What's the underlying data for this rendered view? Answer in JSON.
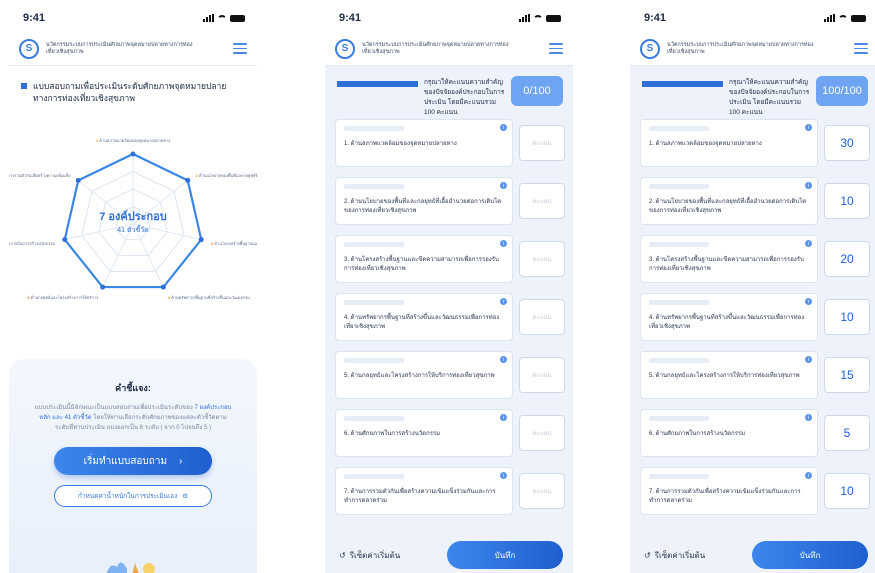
{
  "status": {
    "time": "9:41"
  },
  "app": {
    "title": "นวัตกรรมระบบการประเมินศักยภาพจุดหมายปลายทางการท่องเที่ยวเชิงสุขภาพ"
  },
  "survey": {
    "heading": "แบบสอบถามเพื่อประเมินระดับศักยภาพจุดหมายปลายทางการท่องเที่ยวเชิงสุขภาพ",
    "center_main": "7 องค์ประกอบ",
    "center_sub": "41 ตัวชี้วัด",
    "components": [
      {
        "num": "1",
        "text": "ด้านสภาพแวดล้อมของจุดหมายปลายทาง"
      },
      {
        "num": "2",
        "text": "ด้านนโยบายของพื้นที่และกลยุทธ์ที่เอื้ออำนวยต่อการเติบโต"
      },
      {
        "num": "3",
        "text": "ด้านโครงสร้างพื้นฐานและขีดความสามารถ"
      },
      {
        "num": "4",
        "text": "ด้านทรัพยากรพื้นฐานที่สร้างขึ้นและวัฒนธรรม"
      },
      {
        "num": "5",
        "text": "ด้านกลยุทธ์และโครงสร้างการให้บริการ"
      },
      {
        "num": "6",
        "text": "ด้านศักยภาพในการสร้างนวัตกรรม"
      },
      {
        "num": "7",
        "text": "ด้านการรวมตัวกันเพื่อสร้างความเข้มแข็ง"
      }
    ],
    "instructions_title": "คำชี้แจง:",
    "instructions_pre": "แบบประเมินนี้มีลักษณะเป็นแบบสอบถามเพื่อประเมินระดับของ",
    "instructions_highlight": "7 องค์ประกอบหลัก และ 41 ตัวชี้วัด",
    "instructions_post": "โดยให้ท่านเลือกระดับศักยภาพของแต่ละตัวชี้วัดตามระดับที่ท่านประเมิน แบ่งออกเป็น 6 ระดับ ( จาก 0 ไปจนถึง 5 )",
    "start_label": "เริ่มทำแบบสอบถาม",
    "start_arrow": "›",
    "weight_label": "กำหนดค่าน้ำหนักในการประเมินเอง",
    "gear": "⚙"
  },
  "weights": {
    "instruction": "กรุณาให้คะแนนความสำคัญของปัจจัยองค์ประกอบในการประเมิน โดยมีคะแนนรวม 100 คะแนน",
    "placeholder": "คะแนน",
    "items": [
      "1. ด้านสภาพแวดล้อมของจุดหมายปลายทาง",
      "2. ด้านนโยบายของพื้นที่และกลยุทธ์ที่เอื้ออำนวยต่อการเติบโตของการท่องเที่ยวเชิงสุขภาพ",
      "3. ด้านโครงสร้างพื้นฐานและขีดความสามารถเพื่อการรองรับการท่องเที่ยวเชิงสุขภาพ",
      "4. ด้านทรัพยากรพื้นฐานที่สร้างขึ้นและวัฒนธรรมเพื่อการท่องเที่ยวเชิงสุขภาพ",
      "5. ด้านกลยุทธ์และโครงสร้างการให้บริการท่องเที่ยวสุขภาพ",
      "6. ด้านศักยภาพในการสร้างนวัตกรรม",
      "7. ด้านการรวมตัวกันเพื่อสร้างความเข้มแข็งร่วมกันและการทำการตลาดร่วม"
    ],
    "empty": {
      "total": "0/100"
    },
    "filled": {
      "total": "100/100",
      "values": [
        "30",
        "10",
        "20",
        "10",
        "15",
        "5",
        "10"
      ]
    },
    "reset_label": "รีเซ็ตค่าเริ่มต้น",
    "reset_icon": "↺",
    "save_label": "บันทึก"
  },
  "colors": {
    "accent": "#2e6fd8",
    "total_box": "#6ea4f2",
    "bg": "#eef3fb"
  }
}
